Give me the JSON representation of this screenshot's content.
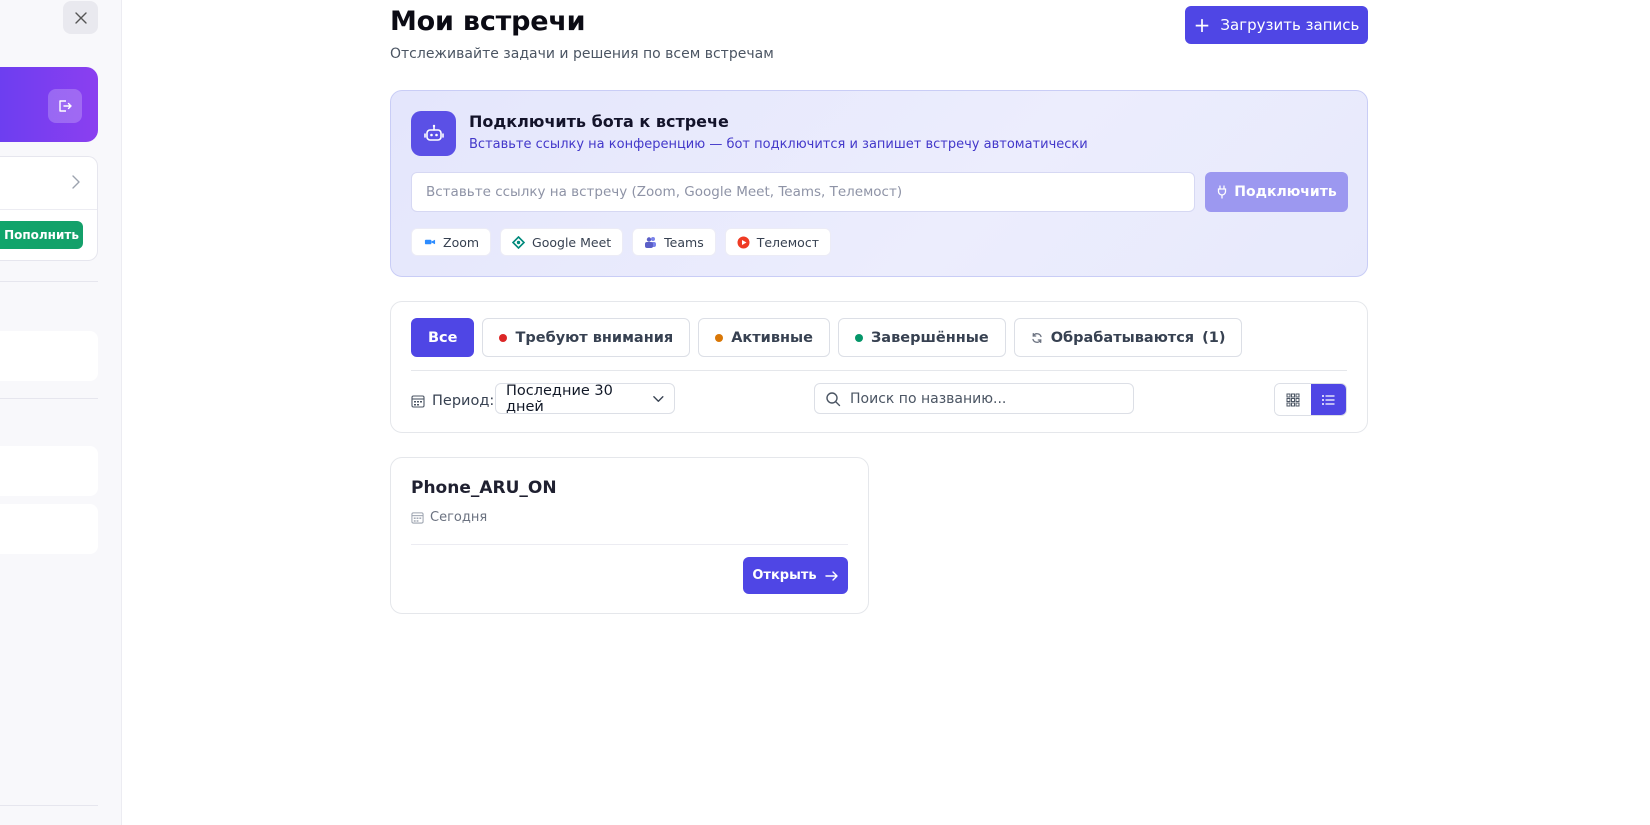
{
  "page": {
    "title": "Мои встречи",
    "subtitle": "Отслеживайте задачи и решения по всем встречам",
    "upload_label": "Загрузить запись"
  },
  "sidebar": {
    "topup_label": "Пополнить"
  },
  "bot_panel": {
    "title": "Подключить бота к встрече",
    "description": "Вставьте ссылку на конференцию — бот подключится и запишет встречу автоматически",
    "input_placeholder": "Вставьте ссылку на встречу (Zoom, Google Meet, Teams, Телемост)",
    "input_value": "",
    "connect_label": "Подключить",
    "platforms": [
      {
        "label": "Zoom",
        "icon": "zoom-icon",
        "color": "#2d8cff"
      },
      {
        "label": "Google Meet",
        "icon": "google-meet-icon",
        "color": "#00897b"
      },
      {
        "label": "Teams",
        "icon": "teams-icon",
        "color": "#5b5fc7"
      },
      {
        "label": "Телемост",
        "icon": "telemost-icon",
        "color": "#ef3b24"
      }
    ]
  },
  "filters": {
    "tabs": [
      {
        "label": "Все",
        "active": true
      },
      {
        "label": "Требуют внимания",
        "dot_color": "#dc2626"
      },
      {
        "label": "Активные",
        "dot_color": "#d97706"
      },
      {
        "label": "Завершённые",
        "dot_color": "#059669"
      },
      {
        "label": "Обрабатываются",
        "count": "(1)"
      }
    ],
    "period_label": "Период:",
    "period_value": "Последние 30 дней",
    "search_placeholder": "Поиск по названию...",
    "view_mode": "list"
  },
  "meetings": [
    {
      "title": "Phone_ARU_ON",
      "date": "Сегодня",
      "open_label": "Открыть"
    }
  ],
  "colors": {
    "accent": "#4f46e5",
    "accent_soft": "#9c98f0",
    "user_card": "#7b3ff0",
    "topup": "#10a56b"
  }
}
